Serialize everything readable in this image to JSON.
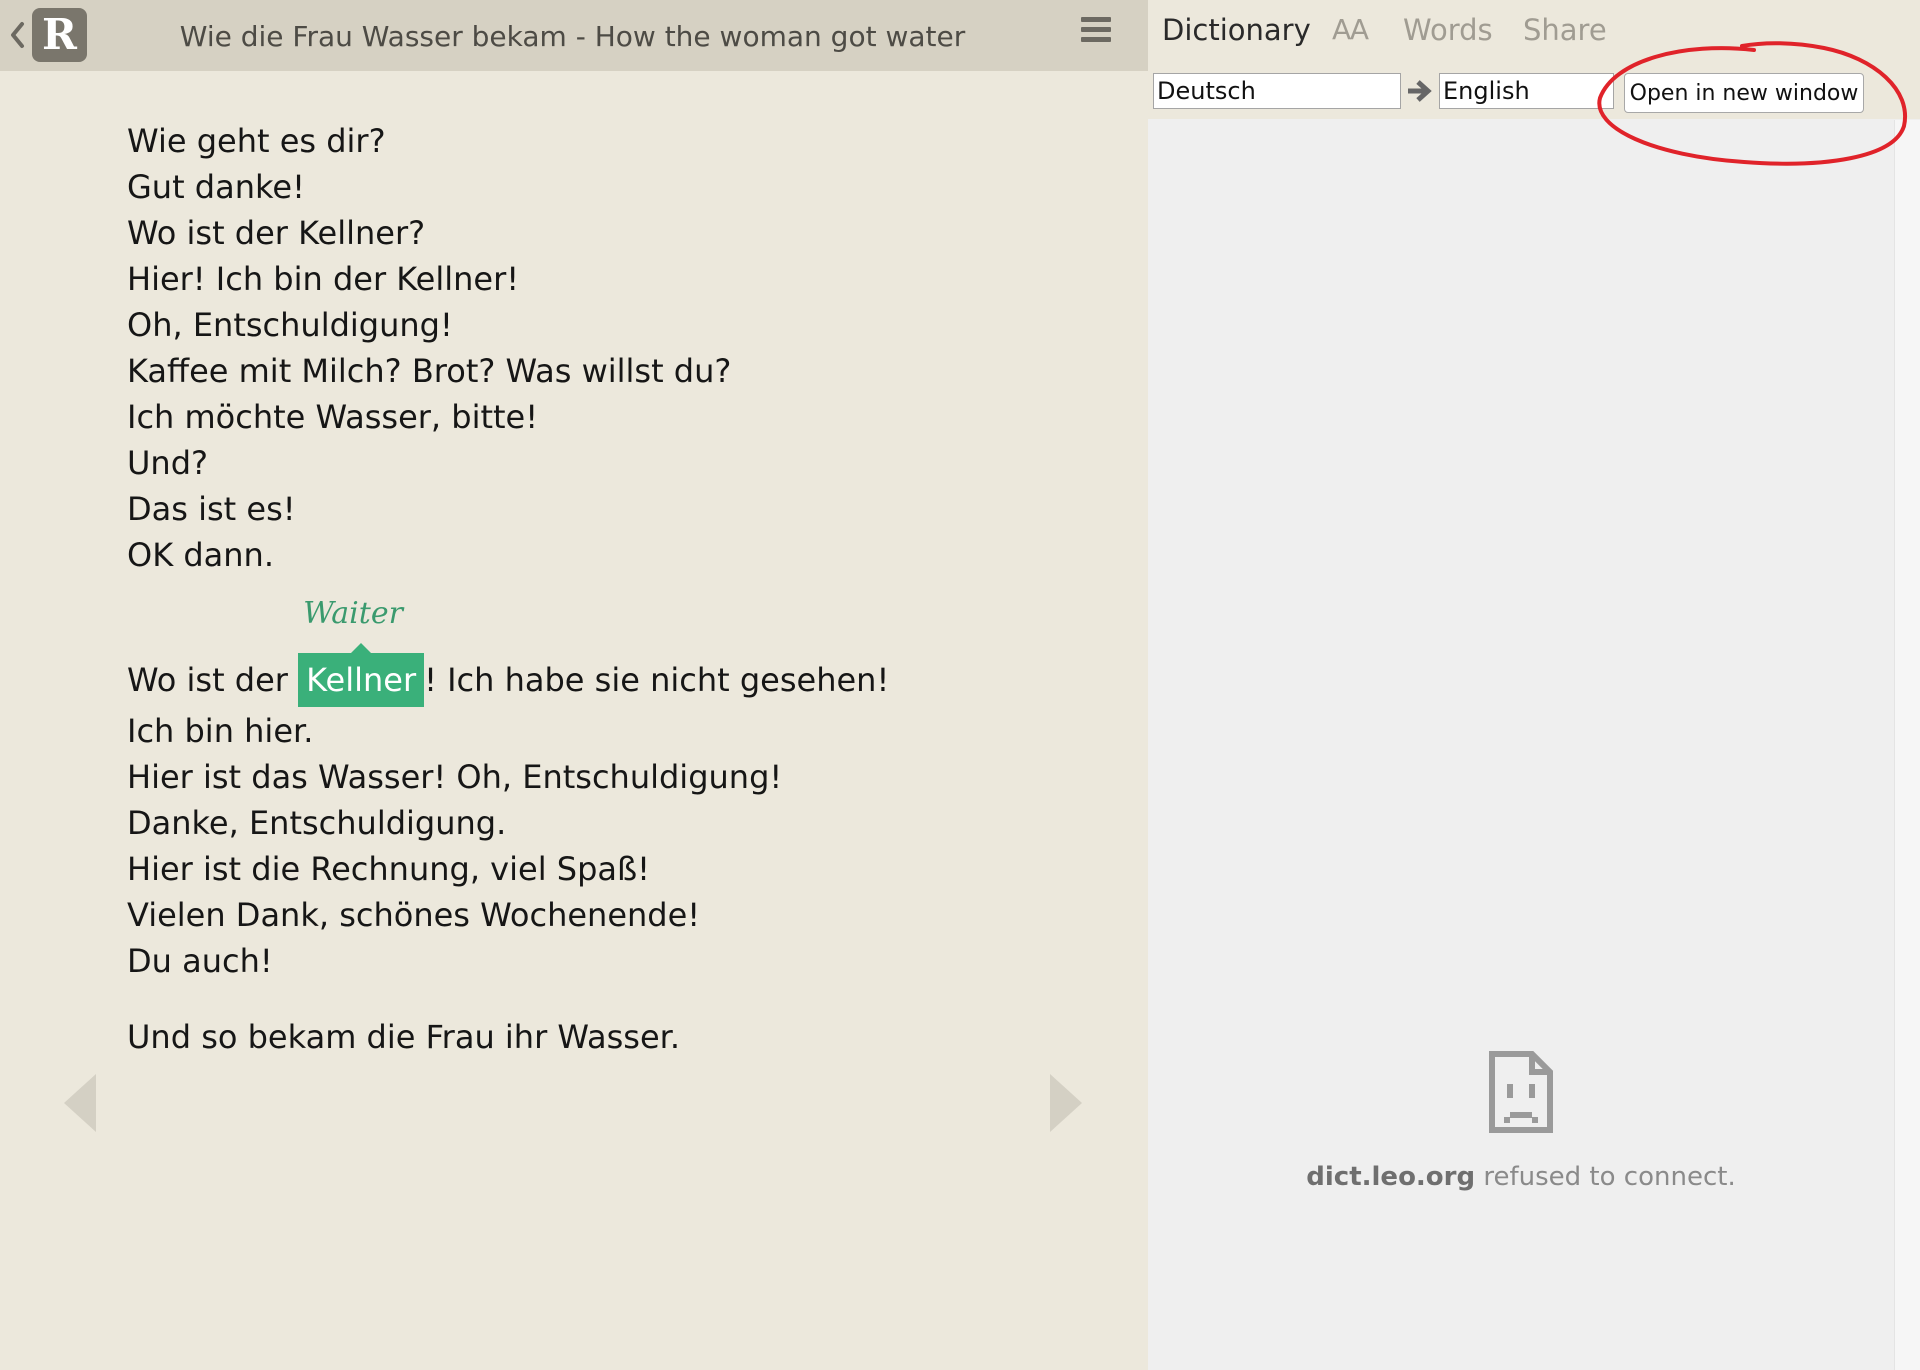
{
  "header": {
    "logo_letter": "R",
    "book_title": "Wie die Frau Wasser bekam - How the woman got water"
  },
  "story": {
    "lines_a": [
      "Wie geht es dir?",
      "Gut danke!",
      "Wo ist der Kellner?",
      "Hier! Ich bin der Kellner!",
      "Oh, Entschuldigung!",
      "Kaffee mit Milch? Brot? Was willst du?",
      "Ich möchte Wasser, bitte!",
      "Und?",
      "Das ist es!",
      "OK dann."
    ],
    "highlight_line": {
      "before": "Wo ist der ",
      "word": "Kellner",
      "after": "! Ich habe sie nicht gesehen!",
      "translation": "Waiter"
    },
    "lines_b": [
      "Ich bin hier.",
      "Hier ist das Wasser! Oh, Entschuldigung!",
      "Danke, Entschuldigung.",
      "Hier ist die Rechnung, viel Spaß!",
      "Vielen Dank, schönes Wochenende!",
      "Du auch!"
    ],
    "closing": "Und so bekam die Frau ihr Wasser."
  },
  "dictionary": {
    "tabs": [
      "Dictionary",
      "AA",
      "Words",
      "Share"
    ],
    "active_tab": "Dictionary",
    "from_language": "Deutsch",
    "to_language": "English",
    "open_button": "Open in new window",
    "error_host": "dict.leo.org",
    "error_message": " refused to connect."
  },
  "colors": {
    "highlight": "#3ab07a",
    "annotation_circle": "#e0232a",
    "background": "#ece8dc"
  },
  "icons": [
    "back-chevron-icon",
    "menu-icon",
    "prev-page-icon",
    "next-page-icon",
    "arrow-right-icon",
    "sad-document-icon"
  ]
}
